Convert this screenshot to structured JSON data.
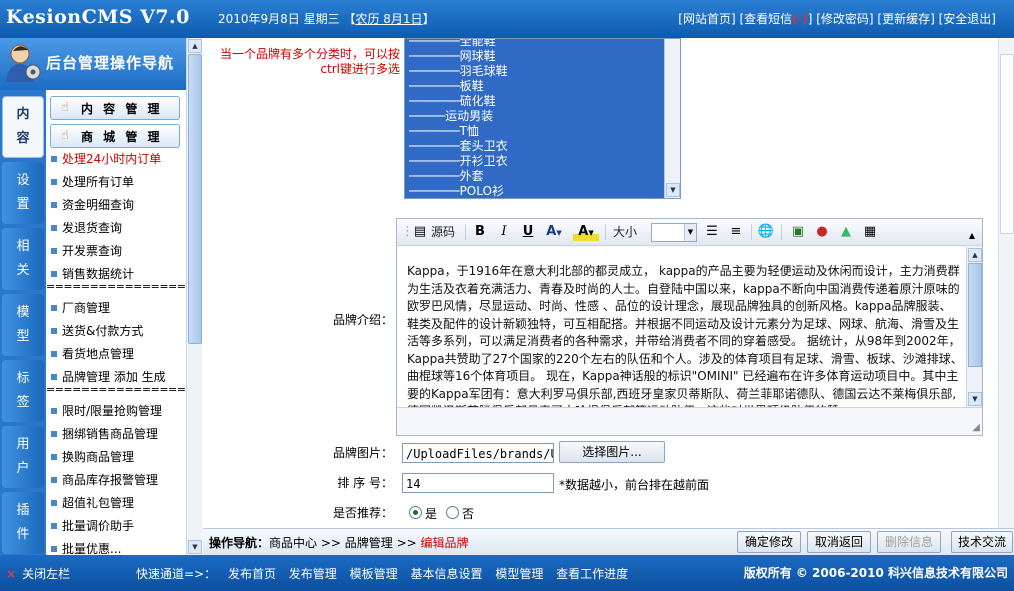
{
  "header": {
    "logo": "KesionCMS V7.0",
    "date": "2010年9月8日  星期三",
    "lunar_prefix": "【",
    "lunar": "农历 8月1日",
    "lunar_suffix": "】",
    "links": [
      "[网站首页]",
      "[查看短信",
      "]",
      "[修改密码]",
      "[更新缓存]",
      "[安全退出]"
    ],
    "unread_dot": "(·)"
  },
  "nav": {
    "title": "后台管理操作导航",
    "vtabs": [
      {
        "label": "内\n容",
        "active": true
      },
      {
        "label": "设\n置",
        "active": false
      },
      {
        "label": "相\n关",
        "active": false
      },
      {
        "label": "模\n型",
        "active": false
      },
      {
        "label": "标\n签",
        "active": false
      },
      {
        "label": "用\n户",
        "active": false
      },
      {
        "label": "插\n件",
        "active": false
      }
    ],
    "menu_buttons": [
      "内 容 管 理",
      "商 城 管 理"
    ],
    "items_group1": [
      "处理24小时内订单",
      "处理所有订单",
      "资金明细查询",
      "发退货查询",
      "开发票查询",
      "销售数据统计"
    ],
    "separator": "========================",
    "items_group2": [
      "厂商管理",
      "送货&付款方式",
      "看货地点管理",
      "品牌管理 添加 生成"
    ],
    "items_group3": [
      "限时/限量抢购管理",
      "捆绑销售商品管理",
      "换购商品管理",
      "商品库存报警管理",
      "超值礼包管理",
      "批量调价助手",
      "批量优惠..."
    ]
  },
  "form": {
    "hint": "当一个品牌有多个分类时，可以按ctrl键进行多选",
    "categories": [
      "───────全能鞋",
      "───────网球鞋",
      "───────羽毛球鞋",
      "───────板鞋",
      "───────硫化鞋",
      "─────运动男装",
      "───────T恤",
      "───────套头卫衣",
      "───────开衫卫衣",
      "───────外套",
      "───────POLO衫"
    ],
    "intro_label": "品牌介绍：",
    "toolbar": {
      "source": "源码",
      "fontsize_label": "大小"
    },
    "intro_text": "Kappa，于1916年在意大利北部的都灵成立， kappa的产品主要为轻便运动及休闲而设计，主力消费群为生活及衣着充满活力、青春及时尚的人士。自登陆中国以来，kappa不断向中国消费传递着原汁原味的欧罗巴风情，尽显运动、时尚、性感 、品位的设计理念，展现品牌独具的创新风格。kappa品牌服装、鞋类及配件的设计新颖独特，可互相配搭。并根据不同运动及设计元素分为足球、网球、航海、滑雪及生活等多系列，可以满足消费者的各种需求，并带给消费者不同的穿着感受。     据统计，从98年到2002年，Kappa共赞助了27个国家的220个左右的队伍和个人。涉及的体育项目有足球、滑雪、板球、沙滩排球、曲棍球等16个体育项目。     现在，Kappa神话般的标识\"OMINI\" 已经遍布在许多体育运动项目中。其中主要的Kappa军团有：意大利罗马俱乐部,西班牙皇家贝蒂斯队、荷兰菲耶诺德队、德国云达不莱梅俱乐部,德国凯泽斯劳滕俱乐部丹麦哥本哈根俱乐部等运动队伍。这些对世界顶级队伍的赞",
    "image_label": "品牌图片：",
    "image_value": "/UploadFiles/brands/U",
    "choose_image": "选择图片...",
    "order_label": "排 序 号：",
    "order_value": "14",
    "order_note": "*数据越小，前台排在越前面",
    "recommend_label": "是否推荐：",
    "recommend_yes": "是",
    "recommend_no": "否",
    "recommend_selected": "yes"
  },
  "opbar": {
    "label": "操作导航：",
    "crumb1": "商品中心",
    "sep": " >> ",
    "crumb2": "品牌管理",
    "current": "编辑品牌",
    "buttons": [
      "确定修改",
      "取消返回",
      "删除信息",
      "技术交流"
    ]
  },
  "footer": {
    "close": "关闭左栏",
    "quick_label": "快速通道=>：",
    "quick": [
      "发布首页",
      "发布管理",
      "模板管理",
      "基本信息设置",
      "模型管理",
      "查看工作进度"
    ],
    "copyright": "版权所有 © 2006-2010 科兴信息技术有限公司"
  },
  "colors": {
    "header_blue": "#0d5bb0",
    "list_selected": "#316ac5",
    "alert_red": "#d40000"
  }
}
